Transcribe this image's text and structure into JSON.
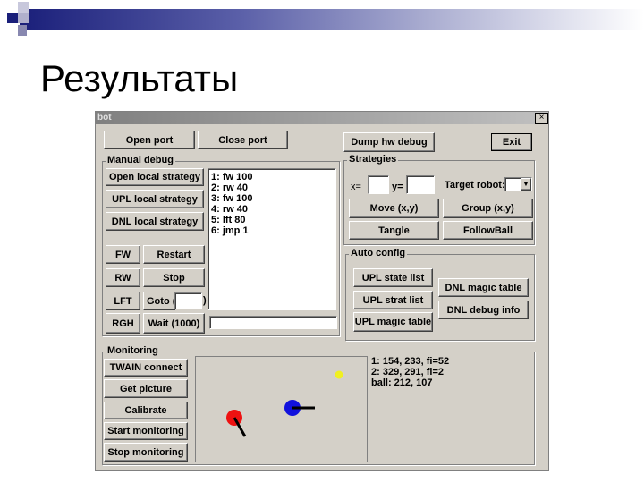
{
  "slide": {
    "title": "Результаты"
  },
  "window": {
    "title": "bot",
    "close": "×"
  },
  "toolbar": {
    "open_port": "Open port",
    "close_port": "Close port",
    "dump": "Dump hw debug",
    "exit": "Exit"
  },
  "manual": {
    "label": "Manual debug",
    "open_local": "Open local strategy",
    "upl_local": "UPL local strategy",
    "dnl_local": "DNL local strategy",
    "program": [
      "1: fw 100",
      "2: rw 40",
      "3: fw 100",
      "4: rw 40",
      "5: lft 80",
      "6: jmp 1"
    ],
    "fw": "FW",
    "restart": "Restart",
    "rw": "RW",
    "stop": "Stop",
    "lft": "LFT",
    "goto": "Goto (",
    "goto_close": ")",
    "goto_value": "",
    "rgh": "RGH",
    "wait": "Wait (1000)",
    "progress": 0
  },
  "strategies": {
    "label": "Strategies",
    "x_label": "x=",
    "y_label": "y=",
    "x_value": "",
    "y_value": "",
    "target_label": "Target robot:",
    "target_value": "",
    "move": "Move (x,y)",
    "group": "Group (x,y)",
    "tangle": "Tangle",
    "follow": "FollowBall"
  },
  "auto": {
    "label": "Auto config",
    "upl_state": "UPL state list",
    "upl_strat": "UPL strat list",
    "upl_magic": "UPL magic table",
    "dnl_magic": "DNL magic table",
    "dnl_debug": "DNL debug info"
  },
  "monitoring": {
    "label": "Monitoring",
    "twain": "TWAIN connect",
    "get_picture": "Get picture",
    "calibrate": "Calibrate",
    "start": "Start monitoring",
    "stop": "Stop monitoring",
    "status": [
      "1: 154, 233, fi=52",
      "2: 329, 291, fi=2",
      "ball: 212, 107"
    ],
    "colors": {
      "robot1": "#ee1111",
      "robot2": "#1111dd",
      "ball": "#f0f020"
    }
  }
}
